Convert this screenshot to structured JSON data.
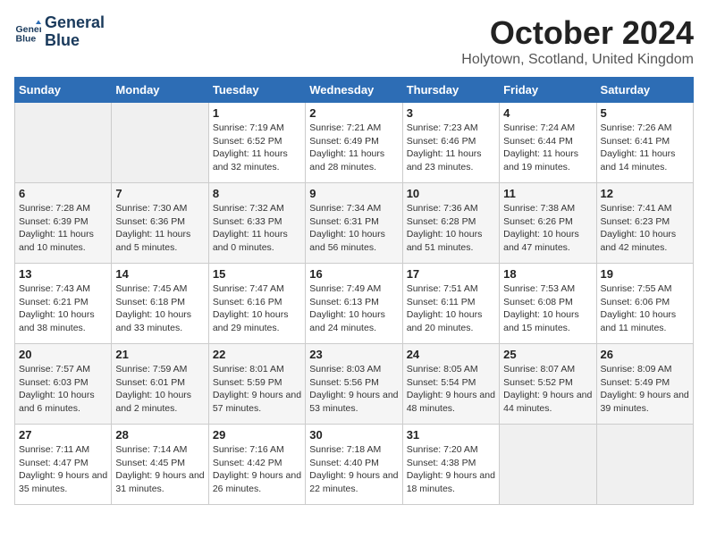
{
  "logo": {
    "line1": "General",
    "line2": "Blue"
  },
  "title": "October 2024",
  "location": "Holytown, Scotland, United Kingdom",
  "weekdays": [
    "Sunday",
    "Monday",
    "Tuesday",
    "Wednesday",
    "Thursday",
    "Friday",
    "Saturday"
  ],
  "weeks": [
    [
      {
        "day": "",
        "sunrise": "",
        "sunset": "",
        "daylight": ""
      },
      {
        "day": "",
        "sunrise": "",
        "sunset": "",
        "daylight": ""
      },
      {
        "day": "1",
        "sunrise": "Sunrise: 7:19 AM",
        "sunset": "Sunset: 6:52 PM",
        "daylight": "Daylight: 11 hours and 32 minutes."
      },
      {
        "day": "2",
        "sunrise": "Sunrise: 7:21 AM",
        "sunset": "Sunset: 6:49 PM",
        "daylight": "Daylight: 11 hours and 28 minutes."
      },
      {
        "day": "3",
        "sunrise": "Sunrise: 7:23 AM",
        "sunset": "Sunset: 6:46 PM",
        "daylight": "Daylight: 11 hours and 23 minutes."
      },
      {
        "day": "4",
        "sunrise": "Sunrise: 7:24 AM",
        "sunset": "Sunset: 6:44 PM",
        "daylight": "Daylight: 11 hours and 19 minutes."
      },
      {
        "day": "5",
        "sunrise": "Sunrise: 7:26 AM",
        "sunset": "Sunset: 6:41 PM",
        "daylight": "Daylight: 11 hours and 14 minutes."
      }
    ],
    [
      {
        "day": "6",
        "sunrise": "Sunrise: 7:28 AM",
        "sunset": "Sunset: 6:39 PM",
        "daylight": "Daylight: 11 hours and 10 minutes."
      },
      {
        "day": "7",
        "sunrise": "Sunrise: 7:30 AM",
        "sunset": "Sunset: 6:36 PM",
        "daylight": "Daylight: 11 hours and 5 minutes."
      },
      {
        "day": "8",
        "sunrise": "Sunrise: 7:32 AM",
        "sunset": "Sunset: 6:33 PM",
        "daylight": "Daylight: 11 hours and 0 minutes."
      },
      {
        "day": "9",
        "sunrise": "Sunrise: 7:34 AM",
        "sunset": "Sunset: 6:31 PM",
        "daylight": "Daylight: 10 hours and 56 minutes."
      },
      {
        "day": "10",
        "sunrise": "Sunrise: 7:36 AM",
        "sunset": "Sunset: 6:28 PM",
        "daylight": "Daylight: 10 hours and 51 minutes."
      },
      {
        "day": "11",
        "sunrise": "Sunrise: 7:38 AM",
        "sunset": "Sunset: 6:26 PM",
        "daylight": "Daylight: 10 hours and 47 minutes."
      },
      {
        "day": "12",
        "sunrise": "Sunrise: 7:41 AM",
        "sunset": "Sunset: 6:23 PM",
        "daylight": "Daylight: 10 hours and 42 minutes."
      }
    ],
    [
      {
        "day": "13",
        "sunrise": "Sunrise: 7:43 AM",
        "sunset": "Sunset: 6:21 PM",
        "daylight": "Daylight: 10 hours and 38 minutes."
      },
      {
        "day": "14",
        "sunrise": "Sunrise: 7:45 AM",
        "sunset": "Sunset: 6:18 PM",
        "daylight": "Daylight: 10 hours and 33 minutes."
      },
      {
        "day": "15",
        "sunrise": "Sunrise: 7:47 AM",
        "sunset": "Sunset: 6:16 PM",
        "daylight": "Daylight: 10 hours and 29 minutes."
      },
      {
        "day": "16",
        "sunrise": "Sunrise: 7:49 AM",
        "sunset": "Sunset: 6:13 PM",
        "daylight": "Daylight: 10 hours and 24 minutes."
      },
      {
        "day": "17",
        "sunrise": "Sunrise: 7:51 AM",
        "sunset": "Sunset: 6:11 PM",
        "daylight": "Daylight: 10 hours and 20 minutes."
      },
      {
        "day": "18",
        "sunrise": "Sunrise: 7:53 AM",
        "sunset": "Sunset: 6:08 PM",
        "daylight": "Daylight: 10 hours and 15 minutes."
      },
      {
        "day": "19",
        "sunrise": "Sunrise: 7:55 AM",
        "sunset": "Sunset: 6:06 PM",
        "daylight": "Daylight: 10 hours and 11 minutes."
      }
    ],
    [
      {
        "day": "20",
        "sunrise": "Sunrise: 7:57 AM",
        "sunset": "Sunset: 6:03 PM",
        "daylight": "Daylight: 10 hours and 6 minutes."
      },
      {
        "day": "21",
        "sunrise": "Sunrise: 7:59 AM",
        "sunset": "Sunset: 6:01 PM",
        "daylight": "Daylight: 10 hours and 2 minutes."
      },
      {
        "day": "22",
        "sunrise": "Sunrise: 8:01 AM",
        "sunset": "Sunset: 5:59 PM",
        "daylight": "Daylight: 9 hours and 57 minutes."
      },
      {
        "day": "23",
        "sunrise": "Sunrise: 8:03 AM",
        "sunset": "Sunset: 5:56 PM",
        "daylight": "Daylight: 9 hours and 53 minutes."
      },
      {
        "day": "24",
        "sunrise": "Sunrise: 8:05 AM",
        "sunset": "Sunset: 5:54 PM",
        "daylight": "Daylight: 9 hours and 48 minutes."
      },
      {
        "day": "25",
        "sunrise": "Sunrise: 8:07 AM",
        "sunset": "Sunset: 5:52 PM",
        "daylight": "Daylight: 9 hours and 44 minutes."
      },
      {
        "day": "26",
        "sunrise": "Sunrise: 8:09 AM",
        "sunset": "Sunset: 5:49 PM",
        "daylight": "Daylight: 9 hours and 39 minutes."
      }
    ],
    [
      {
        "day": "27",
        "sunrise": "Sunrise: 7:11 AM",
        "sunset": "Sunset: 4:47 PM",
        "daylight": "Daylight: 9 hours and 35 minutes."
      },
      {
        "day": "28",
        "sunrise": "Sunrise: 7:14 AM",
        "sunset": "Sunset: 4:45 PM",
        "daylight": "Daylight: 9 hours and 31 minutes."
      },
      {
        "day": "29",
        "sunrise": "Sunrise: 7:16 AM",
        "sunset": "Sunset: 4:42 PM",
        "daylight": "Daylight: 9 hours and 26 minutes."
      },
      {
        "day": "30",
        "sunrise": "Sunrise: 7:18 AM",
        "sunset": "Sunset: 4:40 PM",
        "daylight": "Daylight: 9 hours and 22 minutes."
      },
      {
        "day": "31",
        "sunrise": "Sunrise: 7:20 AM",
        "sunset": "Sunset: 4:38 PM",
        "daylight": "Daylight: 9 hours and 18 minutes."
      },
      {
        "day": "",
        "sunrise": "",
        "sunset": "",
        "daylight": ""
      },
      {
        "day": "",
        "sunrise": "",
        "sunset": "",
        "daylight": ""
      }
    ]
  ]
}
